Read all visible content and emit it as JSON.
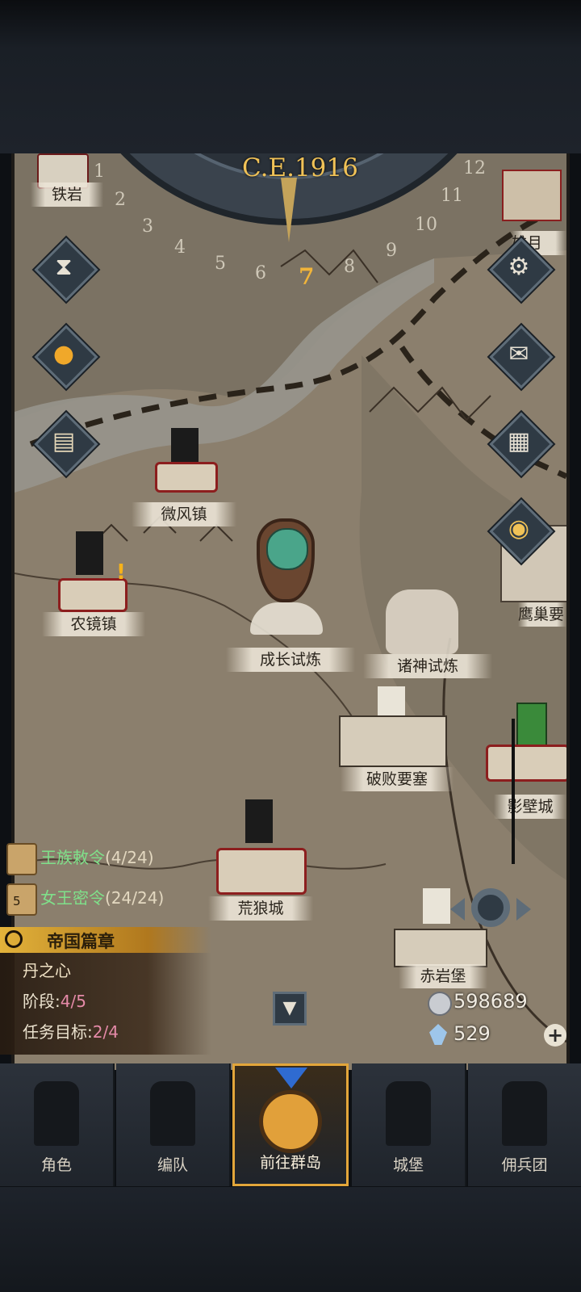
{
  "calendar": {
    "era": "C.E.1916",
    "current_month": "7",
    "months": [
      "1",
      "2",
      "3",
      "4",
      "5",
      "6",
      "7",
      "8",
      "9",
      "10",
      "11",
      "12"
    ]
  },
  "towns": [
    {
      "name": "铁岩"
    },
    {
      "name": "雄月"
    },
    {
      "name": "微风镇"
    },
    {
      "name": "农镜镇"
    },
    {
      "name": "成长试炼"
    },
    {
      "name": "诸神试炼"
    },
    {
      "name": "鹰巢要"
    },
    {
      "name": "破败要塞"
    },
    {
      "name": "影壁城"
    },
    {
      "name": "荒狼城"
    },
    {
      "name": "赤岩堡"
    }
  ],
  "left_buttons": [
    "hourglass-icon",
    "money-bag-icon",
    "scroll-map-icon"
  ],
  "right_buttons": [
    "gear-icon",
    "mail-icon",
    "grid-icon",
    "coin-icon"
  ],
  "quests": [
    {
      "name": "王族敕令",
      "count": "(4/24)"
    },
    {
      "name": "女王密令",
      "count": "(24/24)",
      "badge": "5"
    }
  ],
  "empire_panel": {
    "header": "帝国篇章",
    "title": "丹之心",
    "stage_label": "阶段:",
    "stage_value": "4/5",
    "goal_label": "任务目标:",
    "goal_value": "2/4"
  },
  "resources": {
    "silver": "598689",
    "crystal": "529"
  },
  "tabs": [
    {
      "label": "角色",
      "active": false
    },
    {
      "label": "编队",
      "active": false
    },
    {
      "label": "前往群岛",
      "active": true
    },
    {
      "label": "城堡",
      "active": false
    },
    {
      "label": "佣兵团",
      "active": false
    }
  ],
  "colors": {
    "accent": "#e3a63a",
    "map": "#8b7f6d",
    "quest_green": "#7fe08a"
  }
}
